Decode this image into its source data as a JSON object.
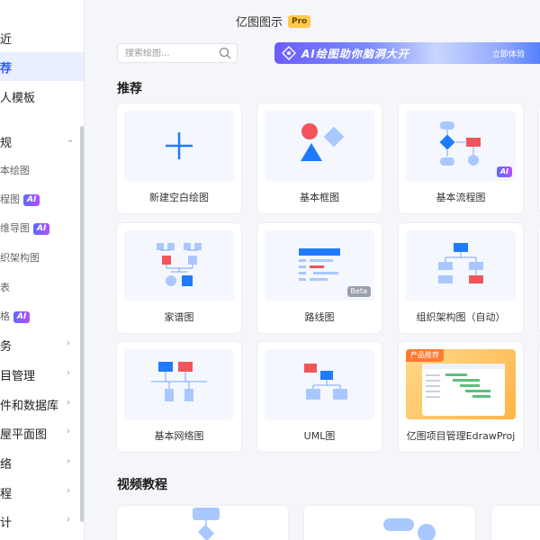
{
  "app": {
    "title": "亿图图示",
    "pro_badge": "Pro"
  },
  "sidebar": {
    "items": [
      {
        "label": "近"
      },
      {
        "label": "荐"
      },
      {
        "label": "人模板"
      },
      {
        "label": "规"
      },
      {
        "label": "本绘图"
      },
      {
        "label": "程图",
        "badge": "AI"
      },
      {
        "label": "维导图",
        "badge": "AI"
      },
      {
        "label": "织架构图"
      },
      {
        "label": "表"
      },
      {
        "label": "格",
        "badge": "AI"
      },
      {
        "label": "务"
      },
      {
        "label": "目管理"
      },
      {
        "label": "件和数据库"
      },
      {
        "label": "屋平面图"
      },
      {
        "label": "络"
      },
      {
        "label": "程"
      },
      {
        "label": "计"
      }
    ]
  },
  "search": {
    "placeholder": "搜索绘图..."
  },
  "ai_banner": {
    "text": "AI绘图助你脑洞大开",
    "cta": "立即体验"
  },
  "sections": {
    "recommended": "推荐",
    "videos": "视频教程"
  },
  "cards": [
    {
      "label": "新建空白绘图"
    },
    {
      "label": "基本框图"
    },
    {
      "label": "基本流程图",
      "badge": "AI"
    },
    {
      "label": "家谱图"
    },
    {
      "label": "路线图",
      "badge": "Beta"
    },
    {
      "label": "组织架构图（自动）"
    },
    {
      "label": "基本网络图"
    },
    {
      "label": "UML图"
    },
    {
      "label": "亿图项目管理EdrawProj",
      "tag": "产品推荐"
    }
  ],
  "colors": {
    "accent": "#2f5dff",
    "blue": "#1e7bff",
    "red": "#f2545b",
    "light_blue": "#a9c8ff"
  }
}
